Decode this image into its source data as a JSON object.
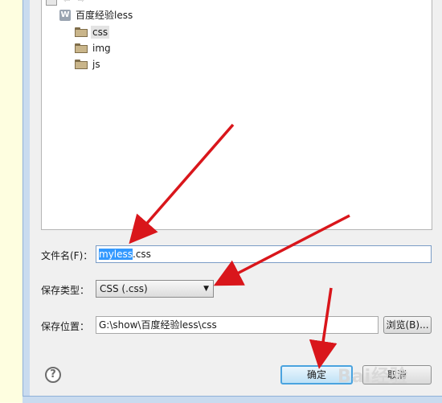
{
  "tree": {
    "toolbar": {
      "home_icon": "home-icon",
      "back_icon": "back-icon",
      "forward_icon": "forward-icon"
    },
    "project": {
      "label": "百度经验less",
      "icon": "web-project-icon",
      "icon_glyph": "W"
    },
    "folders": [
      {
        "label": "css",
        "icon": "folder-icon",
        "selected": true
      },
      {
        "label": "img",
        "icon": "folder-icon",
        "selected": false
      },
      {
        "label": "js",
        "icon": "folder-icon",
        "selected": false
      }
    ]
  },
  "form": {
    "filename_label": "文件名(F)：",
    "filename_selected": "myless",
    "filename_rest": ".css",
    "type_label": "保存类型：",
    "type_value": "CSS (.css)",
    "location_label": "保存位置：",
    "location_value": "G:\\show\\百度经验less\\css",
    "browse_label": "浏览(B)..."
  },
  "buttons": {
    "ok_label": "确定",
    "cancel_label": "取消",
    "help_glyph": "?"
  },
  "colors": {
    "selection": "#3399ff",
    "arrow": "#d9161b",
    "default_button_border": "#4aa3df"
  }
}
